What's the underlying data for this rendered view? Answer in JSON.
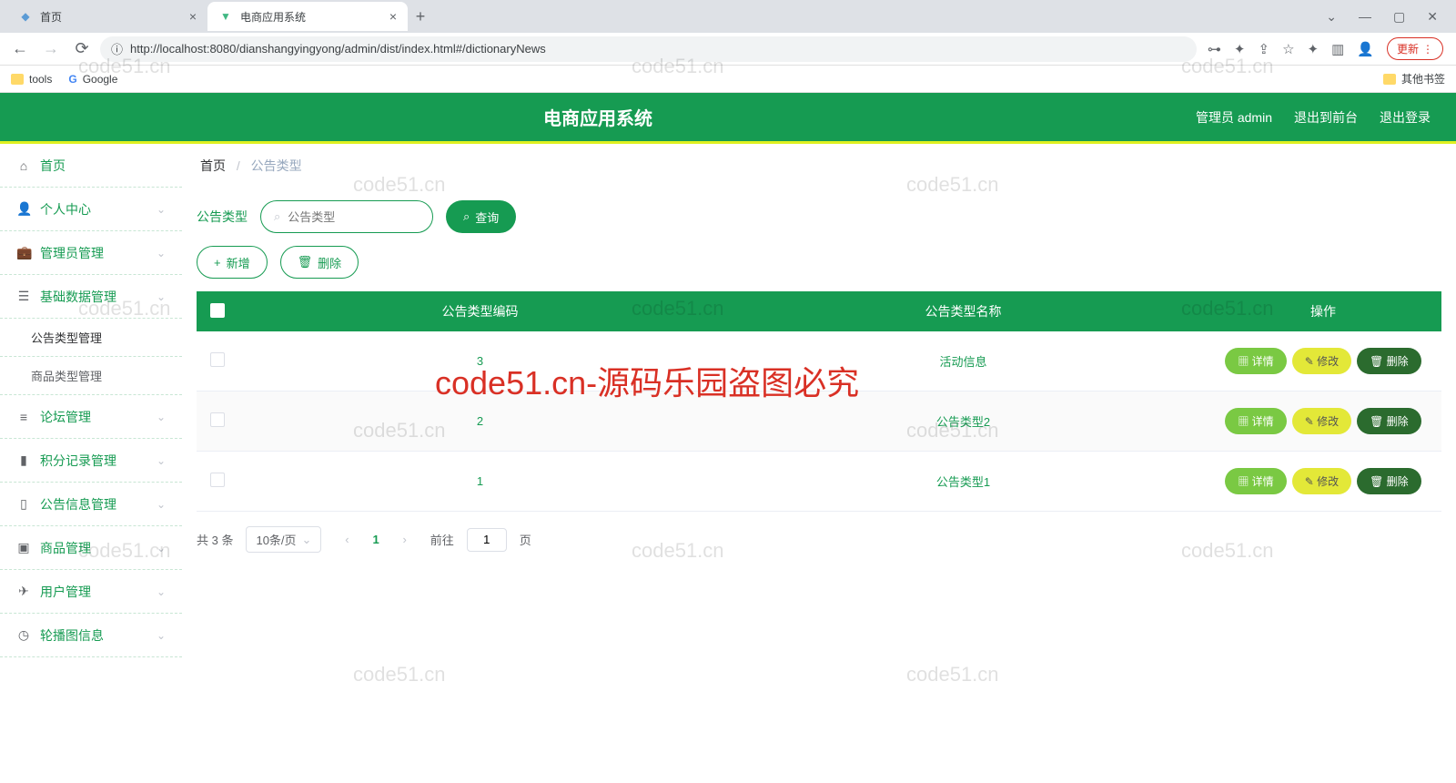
{
  "browser": {
    "tabs": [
      {
        "title": "首页",
        "active": false
      },
      {
        "title": "电商应用系统",
        "active": true
      }
    ],
    "url": "http://localhost:8080/dianshangyingyong/admin/dist/index.html#/dictionaryNews",
    "updateLabel": "更新",
    "bookmarks": {
      "tools": "tools",
      "google": "Google",
      "other": "其他书签"
    }
  },
  "header": {
    "title": "电商应用系统",
    "user": "管理员 admin",
    "logoutFront": "退出到前台",
    "logout": "退出登录"
  },
  "sidebar": {
    "home": "首页",
    "items": [
      {
        "label": "个人中心"
      },
      {
        "label": "管理员管理"
      },
      {
        "label": "基础数据管理",
        "expanded": true,
        "children": [
          {
            "label": "公告类型管理",
            "active": true
          },
          {
            "label": "商品类型管理"
          }
        ]
      },
      {
        "label": "论坛管理"
      },
      {
        "label": "积分记录管理"
      },
      {
        "label": "公告信息管理"
      },
      {
        "label": "商品管理"
      },
      {
        "label": "用户管理"
      },
      {
        "label": "轮播图信息"
      }
    ]
  },
  "breadcrumb": {
    "home": "首页",
    "current": "公告类型"
  },
  "search": {
    "label": "公告类型",
    "placeholder": "公告类型",
    "query": "查询"
  },
  "actions": {
    "add": "新增",
    "delete": "删除"
  },
  "table": {
    "headers": {
      "code": "公告类型编码",
      "name": "公告类型名称",
      "ops": "操作"
    },
    "rows": [
      {
        "code": "3",
        "name": "活动信息"
      },
      {
        "code": "2",
        "name": "公告类型2"
      },
      {
        "code": "1",
        "name": "公告类型1"
      }
    ],
    "opLabels": {
      "detail": "详情",
      "edit": "修改",
      "delete": "删除"
    }
  },
  "pagination": {
    "total": "共 3 条",
    "pageSize": "10条/页",
    "current": "1",
    "goto": "前往",
    "page": "页",
    "input": "1"
  },
  "watermark": "code51.cn",
  "watermarkRed": "code51.cn-源码乐园盗图必究"
}
